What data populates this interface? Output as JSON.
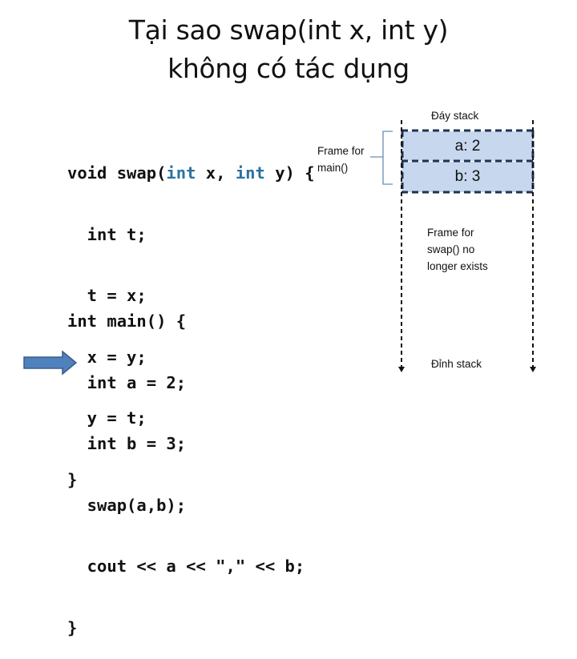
{
  "title": {
    "line1": "Tại sao swap(int x, int y)",
    "line2": "không có tác dụng"
  },
  "swap_code": {
    "line1_pre": "void swap(",
    "line1_kw1": "int",
    "line1_mid": " x, ",
    "line1_kw2": "int",
    "line1_post": " y) {",
    "lines": [
      "  int t;",
      "  t = x;",
      "  x = y;",
      "  y = t;",
      "}"
    ]
  },
  "main_code": {
    "lines": [
      "int main() {",
      "  int a = 2;",
      "  int b = 3;",
      "  swap(a,b);",
      "  cout << a << \",\" << b;",
      "}"
    ],
    "current_line_index": 4
  },
  "frame_main_label": [
    "Frame for",
    "main()"
  ],
  "stack": {
    "bottom_label": "Đáy stack",
    "top_label": "Đỉnh stack",
    "cells": [
      "a: 2",
      "b: 3"
    ],
    "swap_frame_note": [
      "Frame for",
      "swap() no",
      "longer exists"
    ]
  },
  "colors": {
    "keyword": "#2a73a0",
    "stack_fill": "#c6d7ee",
    "stack_border": "#1f3350",
    "arrow_fill": "#4f81bd",
    "arrow_stroke": "#385d8a",
    "brace": "#6a8db5"
  }
}
